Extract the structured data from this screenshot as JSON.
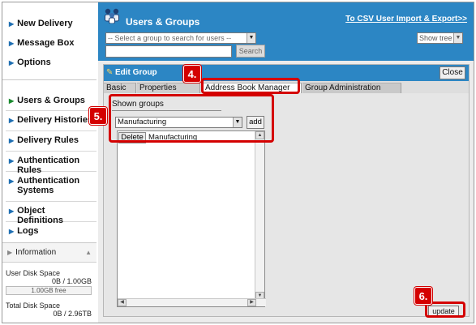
{
  "sidebar": {
    "top_items": [
      "New Delivery",
      "Message Box",
      "Options"
    ],
    "admin_items": [
      "Users & Groups",
      "Delivery Histories",
      "Delivery Rules",
      "Authentication Rules",
      "Authentication Systems",
      "Object Definitions",
      "Logs"
    ],
    "info": {
      "title": "Information",
      "user_disk_label": "User Disk Space",
      "user_disk_value": "0B / 1.00GB",
      "user_disk_free": "1.00GB free",
      "total_disk_label": "Total Disk Space",
      "total_disk_value": "0B / 2.96TB"
    }
  },
  "header": {
    "title": "Users & Groups",
    "csv_link": "To CSV User Import & Export>>",
    "group_select_placeholder": "-- Select a group to search for users --",
    "show_tree": "Show tree",
    "search_button": "Search"
  },
  "edit_group": {
    "title": "Edit Group",
    "close_button": "Close",
    "tabs": [
      "Basic",
      "Properties",
      "Address Book Manager",
      "Group Administration"
    ],
    "active_tab": "Address Book Manager",
    "shown_groups_label": "Shown groups",
    "group_combo_value": "Manufacturing",
    "add_button": "add",
    "delete_button": "Delete",
    "listed_group": "Manufacturing",
    "update_button": "update"
  },
  "annotations": {
    "step4": "4.",
    "step5": "5.",
    "step6": "6."
  },
  "colors": {
    "header_blue": "#2c86c4",
    "callout_red": "#d40000"
  }
}
